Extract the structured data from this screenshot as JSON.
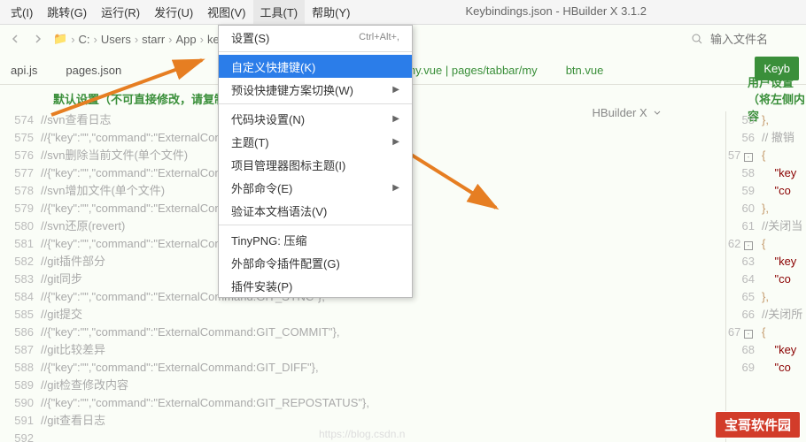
{
  "title": "Keybindings.json - HBuilder X 3.1.2",
  "menubar": [
    {
      "label": "式(I)"
    },
    {
      "label": "跳转(G)"
    },
    {
      "label": "运行(R)"
    },
    {
      "label": "发行(U)"
    },
    {
      "label": "视图(V)"
    },
    {
      "label": "工具(T)"
    },
    {
      "label": "帮助(Y)"
    }
  ],
  "activeMenuIndex": 5,
  "breadcrumb": [
    "C:",
    "Users",
    "starr",
    "App",
    "keybindings.json"
  ],
  "searchPlaceholder": "输入文件名",
  "tabs": {
    "api": "api.js",
    "pages": "pages.json",
    "my": "*my.vue | pages/tabbar/my",
    "btn": "btn.vue",
    "keyb": "Keyb"
  },
  "hbuilderx": "HBuilder X",
  "headers": {
    "left": "默认设置（不可直接修改，请复制",
    "right": "用户设置（将左侧内容"
  },
  "dropdown": [
    {
      "label": "设置(S)",
      "shortcut": "Ctrl+Alt+,"
    },
    {
      "sep": true
    },
    {
      "label": "自定义快捷键(K)",
      "hl": true
    },
    {
      "label": "预设快捷键方案切换(W)",
      "arrow": true
    },
    {
      "sep": true
    },
    {
      "label": "代码块设置(N)",
      "arrow": true
    },
    {
      "label": "主题(T)",
      "arrow": true
    },
    {
      "label": "项目管理器图标主题(I)"
    },
    {
      "label": "外部命令(E)",
      "arrow": true
    },
    {
      "label": "验证本文档语法(V)"
    },
    {
      "sep": true
    },
    {
      "label": "TinyPNG: 压缩"
    },
    {
      "label": "外部命令插件配置(G)"
    },
    {
      "label": "插件安装(P)"
    }
  ],
  "left": {
    "start": 574,
    "lines": [
      "//svn查看日志",
      "//{\"key\":\"\",\"command\":\"ExternalCommand:SVN_LOG\"},",
      "//svn删除当前文件(单个文件)",
      "//{\"key\":\"\",\"command\":\"ExternalCommand:SVN_REMOVE\"},",
      "//svn增加文件(单个文件)",
      "//{\"key\":\"\",\"command\":\"ExternalCommand:SVN_ADD\"},",
      "//svn还原(revert)",
      "//{\"key\":\"\",\"command\":\"ExternalCommand:SVN_REVERT\"},",
      "",
      "//git插件部分",
      "//git同步",
      "//{\"key\":\"\",\"command\":\"ExternalCommand:GIT_SYNC\"},",
      "//git提交",
      "//{\"key\":\"\",\"command\":\"ExternalCommand:GIT_COMMIT\"},",
      "//git比较差异",
      "//{\"key\":\"\",\"command\":\"ExternalCommand:GIT_DIFF\"},",
      "//git检查修改内容",
      "//{\"key\":\"\",\"command\":\"ExternalCommand:GIT_REPOSTATUS\"},",
      "//git查看日志"
    ]
  },
  "right": {
    "items": [
      {
        "ln": 55,
        "txt": "},"
      },
      {
        "ln": 56,
        "txt": "// 撤销",
        "c": true
      },
      {
        "ln": 57,
        "txt": "{",
        "fold": true
      },
      {
        "ln": 58,
        "txt": "\"key",
        "k": true
      },
      {
        "ln": 59,
        "txt": "\"co",
        "k": true
      },
      {
        "ln": 60,
        "txt": "},"
      },
      {
        "ln": 61,
        "txt": "//关闭当",
        "c": true
      },
      {
        "ln": 62,
        "txt": "{",
        "fold": true
      },
      {
        "ln": 63,
        "txt": "\"key",
        "k": true
      },
      {
        "ln": 64,
        "txt": "\"co",
        "k": true
      },
      {
        "ln": 65,
        "txt": "},"
      },
      {
        "ln": 66,
        "txt": "//关闭所",
        "c": true
      },
      {
        "ln": 67,
        "txt": "{",
        "fold": true
      },
      {
        "ln": 68,
        "txt": "\"key",
        "k": true
      },
      {
        "ln": 69,
        "txt": "\"co",
        "k": true
      }
    ]
  },
  "watermark": "宝哥软件园",
  "csdn": "https://blog.csdn.n"
}
